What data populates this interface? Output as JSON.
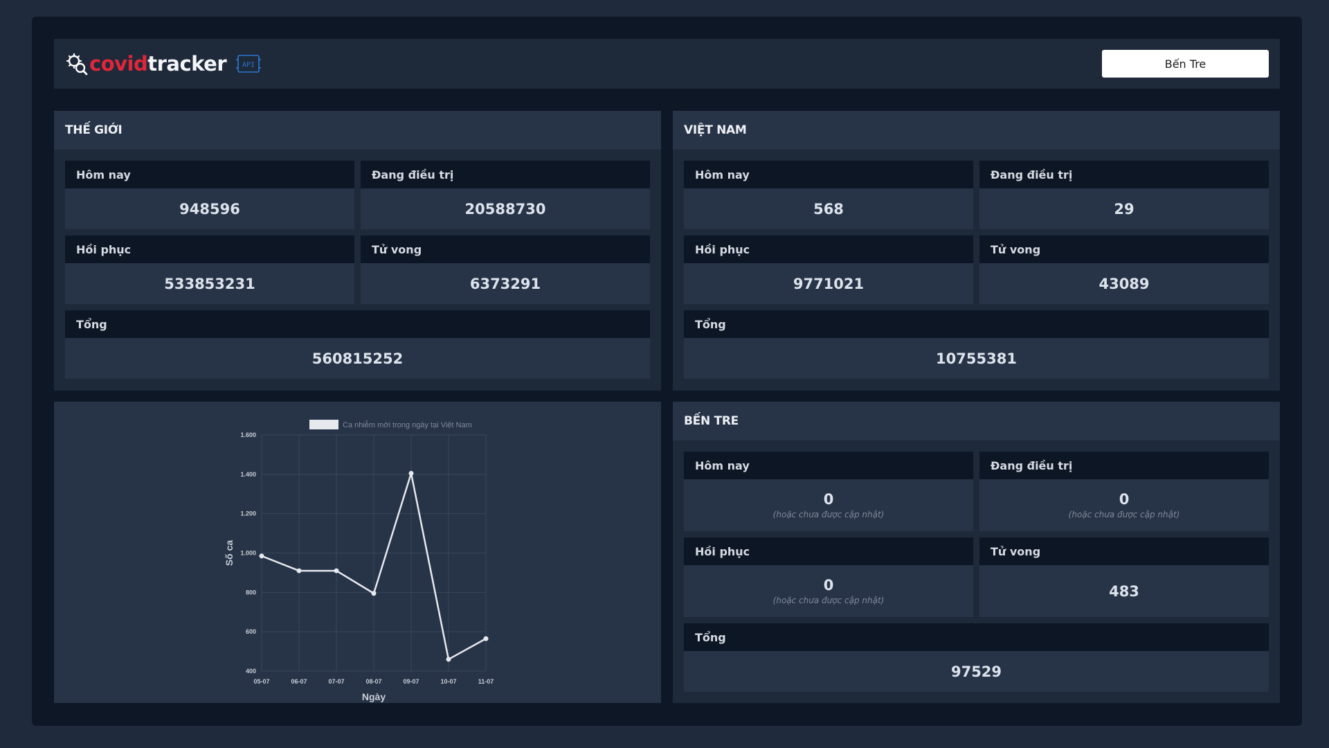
{
  "header": {
    "logo": {
      "covid": "covid",
      "tracker": "tracker",
      "api_label": "API"
    },
    "region_select": "Bến Tre"
  },
  "colors": {
    "brand_red": "#e0263a",
    "badge_blue": "#2b78d6",
    "background": "#0e1725",
    "panel": "#1e2939"
  },
  "world": {
    "title": "THẾ GIỚI",
    "today": {
      "label": "Hôm nay",
      "value": "948596"
    },
    "treating": {
      "label": "Đang điều trị",
      "value": "20588730"
    },
    "recovered": {
      "label": "Hồi phục",
      "value": "533853231"
    },
    "deaths": {
      "label": "Tử vong",
      "value": "6373291"
    },
    "total": {
      "label": "Tổng",
      "value": "560815252"
    }
  },
  "vietnam": {
    "title": "VIỆT NAM",
    "today": {
      "label": "Hôm nay",
      "value": "568"
    },
    "treating": {
      "label": "Đang điều trị",
      "value": "29"
    },
    "recovered": {
      "label": "Hồi phục",
      "value": "9771021"
    },
    "deaths": {
      "label": "Tử vong",
      "value": "43089"
    },
    "total": {
      "label": "Tổng",
      "value": "10755381"
    }
  },
  "province": {
    "title": "BẾN TRE",
    "today": {
      "label": "Hôm nay",
      "value": "0",
      "note": "(hoặc chưa được cập nhật)"
    },
    "treating": {
      "label": "Đang điều trị",
      "value": "0",
      "note": "(hoặc chưa được cập nhật)"
    },
    "recovered": {
      "label": "Hồi phục",
      "value": "0",
      "note": "(hoặc chưa được cập nhật)"
    },
    "deaths": {
      "label": "Tử vong",
      "value": "483"
    },
    "total": {
      "label": "Tổng",
      "value": "97529"
    }
  },
  "chart_data": {
    "type": "line",
    "categories": [
      "05-07",
      "06-07",
      "07-07",
      "08-07",
      "09-07",
      "10-07",
      "11-07"
    ],
    "series": [
      {
        "name": "Ca nhiễm mới trong ngày tại Việt Nam",
        "values": [
          985,
          910,
          910,
          795,
          1405,
          460,
          565
        ]
      }
    ],
    "xlabel": "Ngày",
    "ylabel": "Số ca",
    "ylim": [
      400,
      1600
    ],
    "yticks": [
      400,
      600,
      800,
      1000,
      1200,
      1400,
      1600
    ],
    "ytick_labels": [
      "400",
      "600",
      "800",
      "1.000",
      "1.200",
      "1.400",
      "1.600"
    ],
    "grid": true,
    "legend": "top",
    "line_color": "#e6e9ee"
  }
}
